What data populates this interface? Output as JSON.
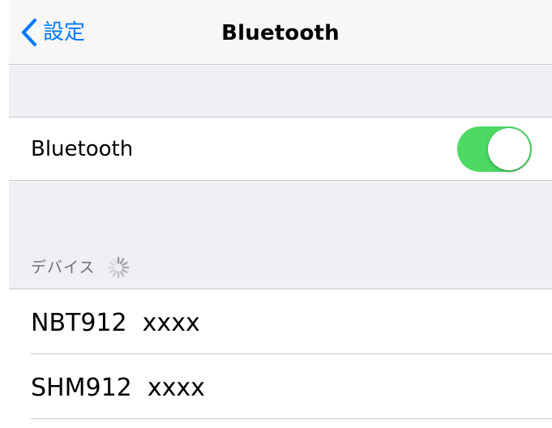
{
  "navbar": {
    "back_label": "設定",
    "title": "Bluetooth"
  },
  "bluetooth_section": {
    "label": "Bluetooth",
    "toggle_on": true,
    "toggle_color": "#4cd964"
  },
  "devices_section": {
    "header": "デバイス",
    "loading_icon": "activity-spinner-icon",
    "devices": [
      {
        "name": "NBT912  xxxx"
      },
      {
        "name": "SHM912  xxxx"
      }
    ]
  },
  "colors": {
    "accent": "#007aff",
    "background_gray": "#efeff4",
    "separator": "#c8c7cc",
    "section_header_text": "#6d6d72"
  }
}
